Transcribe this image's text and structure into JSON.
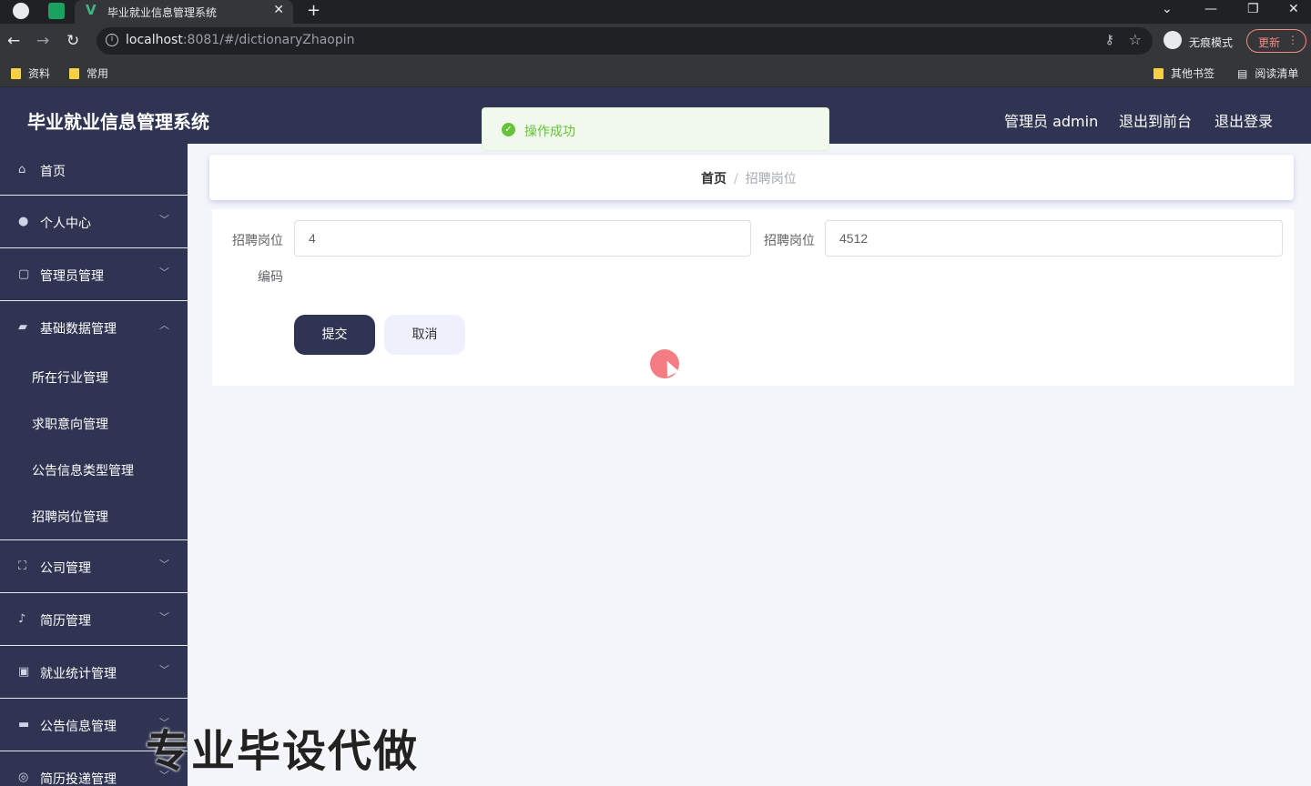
{
  "browser": {
    "tab_title": "毕业就业信息管理系统",
    "url_host": "localhost",
    "url_path": ":8081/#/dictionaryZhaopin",
    "incognito_label": "无痕模式",
    "update_label": "更新",
    "bookmarks": [
      "资料",
      "常用"
    ],
    "bookmarks_right": [
      "其他书签",
      "阅读清单"
    ]
  },
  "header": {
    "title": "毕业就业信息管理系统",
    "user": "管理员 admin",
    "to_front": "退出到前台",
    "logout": "退出登录"
  },
  "toast": {
    "message": "操作成功"
  },
  "sidebar": {
    "items": [
      {
        "label": "首页",
        "icon": "home-icon"
      },
      {
        "label": "个人中心",
        "icon": "user-icon"
      },
      {
        "label": "管理员管理",
        "icon": "box-icon"
      },
      {
        "label": "基础数据管理",
        "icon": "folder-icon"
      },
      {
        "label": "公司管理",
        "icon": "fullscreen-icon"
      },
      {
        "label": "简历管理",
        "icon": "microphone-icon"
      },
      {
        "label": "就业统计管理",
        "icon": "clipboard-icon"
      },
      {
        "label": "公告信息管理",
        "icon": "briefcase-icon"
      },
      {
        "label": "简历投递管理",
        "icon": "circle-icon"
      }
    ],
    "subitems": [
      "所在行业管理",
      "求职意向管理",
      "公告信息类型管理",
      "招聘岗位管理"
    ]
  },
  "breadcrumb": {
    "home": "首页",
    "separator": "/",
    "current": "招聘岗位"
  },
  "form": {
    "field1_label_a": "招聘岗位",
    "field1_label_b": "编码",
    "field1_value": "4",
    "field2_label": "招聘岗位",
    "field2_value": "4512",
    "submit": "提交",
    "cancel": "取消"
  },
  "watermark": "专业毕设代做"
}
